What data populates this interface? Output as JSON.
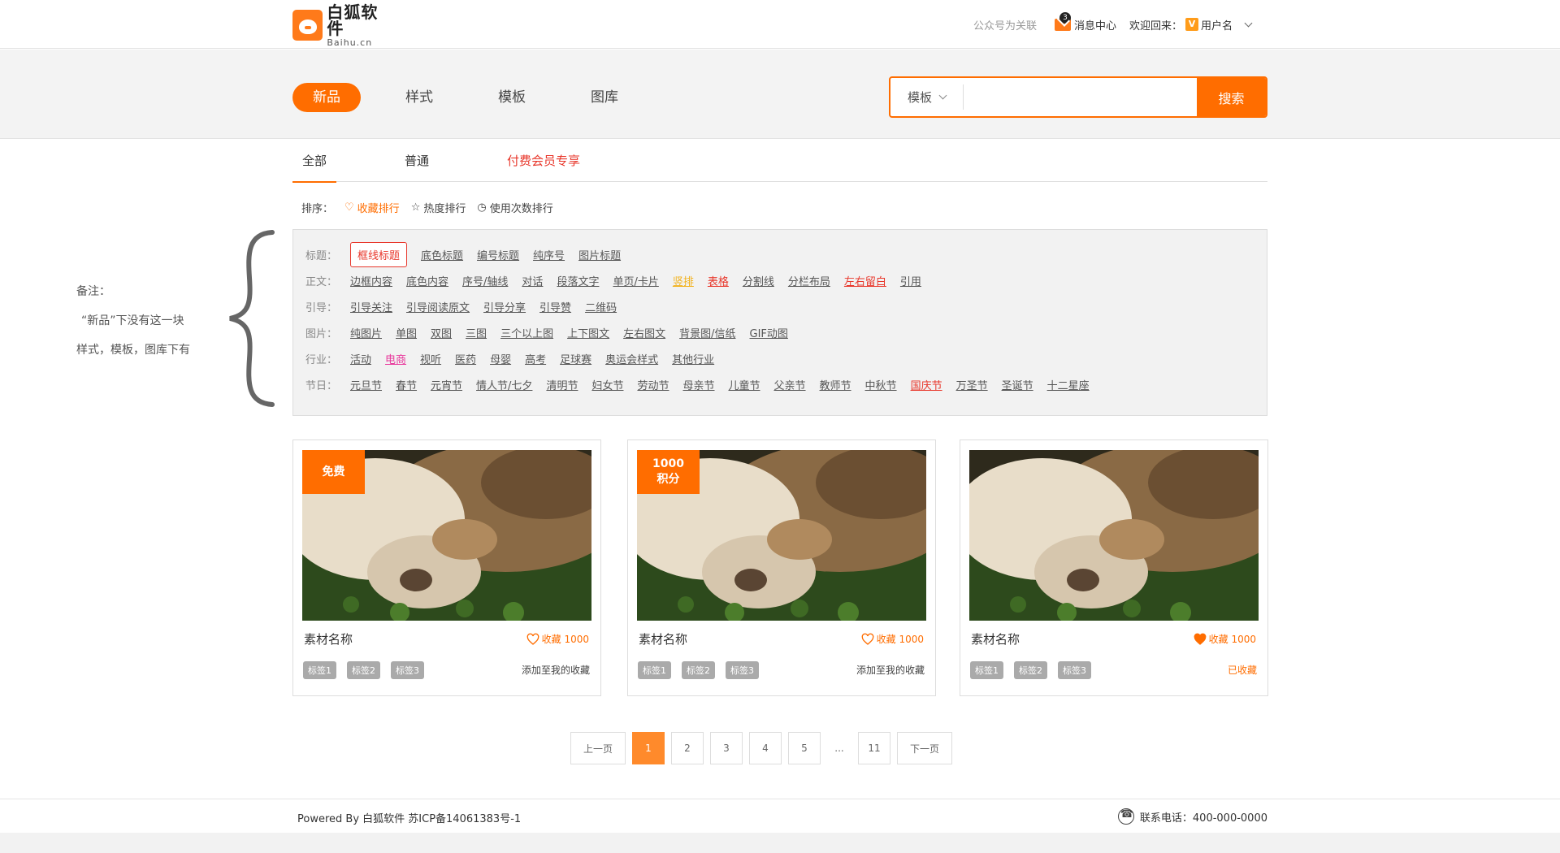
{
  "header": {
    "logo_cn": "白狐软件",
    "logo_en": "Baihu.cn",
    "follow": "公众号为关联",
    "message_count": "3",
    "message_center": "消息中心",
    "welcome": "欢迎回来：",
    "vip_icon": "V",
    "username": "用户名"
  },
  "nav": {
    "tabs": [
      {
        "label": "新品",
        "active": true
      },
      {
        "label": "样式"
      },
      {
        "label": "模板"
      },
      {
        "label": "图库"
      }
    ]
  },
  "search": {
    "type": "模板",
    "placeholder": "",
    "button": "搜索"
  },
  "subtabs": [
    {
      "label": "全部",
      "active": true
    },
    {
      "label": "普通"
    },
    {
      "label": "付费会员专享"
    }
  ],
  "sort": {
    "label": "排序：",
    "items": [
      {
        "icon": "heart-icon",
        "label": "收藏排行",
        "active": true
      },
      {
        "icon": "star-icon",
        "label": "热度排行"
      },
      {
        "icon": "clock-icon",
        "label": "使用次数排行"
      }
    ]
  },
  "note": {
    "line1": "备注：",
    "line2": "“新品”下没有这一块",
    "line3": "样式，模板，图库下有"
  },
  "filters": [
    {
      "label": "标题：",
      "items": [
        {
          "text": "框线标题",
          "style": "sel"
        },
        {
          "text": "底色标题"
        },
        {
          "text": "编号标题"
        },
        {
          "text": "纯序号"
        },
        {
          "text": "图片标题"
        }
      ]
    },
    {
      "label": "正文：",
      "items": [
        {
          "text": "边框内容"
        },
        {
          "text": "底色内容"
        },
        {
          "text": "序号/轴线"
        },
        {
          "text": "对话"
        },
        {
          "text": "段落文字"
        },
        {
          "text": "单页/卡片"
        },
        {
          "text": "竖排",
          "style": "orange"
        },
        {
          "text": "表格",
          "style": "red"
        },
        {
          "text": "分割线"
        },
        {
          "text": "分栏布局"
        },
        {
          "text": "左右留白",
          "style": "red"
        },
        {
          "text": "引用"
        }
      ]
    },
    {
      "label": "引导：",
      "items": [
        {
          "text": "引导关注"
        },
        {
          "text": "引导阅读原文"
        },
        {
          "text": "引导分享"
        },
        {
          "text": "引导赞"
        },
        {
          "text": "二维码"
        }
      ]
    },
    {
      "label": "图片：",
      "items": [
        {
          "text": "纯图片"
        },
        {
          "text": "单图"
        },
        {
          "text": "双图"
        },
        {
          "text": "三图"
        },
        {
          "text": "三个以上图"
        },
        {
          "text": "上下图文"
        },
        {
          "text": "左右图文"
        },
        {
          "text": "背景图/信纸"
        },
        {
          "text": "GIF动图"
        }
      ]
    },
    {
      "label": "行业：",
      "items": [
        {
          "text": "活动"
        },
        {
          "text": "电商",
          "style": "pink"
        },
        {
          "text": "视听"
        },
        {
          "text": "医药"
        },
        {
          "text": "母婴"
        },
        {
          "text": "高考"
        },
        {
          "text": "足球赛"
        },
        {
          "text": "奥运会样式"
        },
        {
          "text": "其他行业"
        }
      ]
    },
    {
      "label": "节日：",
      "items": [
        {
          "text": "元旦节"
        },
        {
          "text": "春节"
        },
        {
          "text": "元宵节"
        },
        {
          "text": "情人节/七夕"
        },
        {
          "text": "清明节"
        },
        {
          "text": "妇女节"
        },
        {
          "text": "劳动节"
        },
        {
          "text": "母亲节"
        },
        {
          "text": "儿童节"
        },
        {
          "text": "父亲节"
        },
        {
          "text": "教师节"
        },
        {
          "text": "中秋节"
        },
        {
          "text": "国庆节",
          "style": "red"
        },
        {
          "text": "万圣节"
        },
        {
          "text": "圣诞节"
        },
        {
          "text": "十二星座"
        }
      ]
    }
  ],
  "cards": [
    {
      "badge": "免费",
      "title": "素材名称",
      "fav_label": "收藏",
      "fav_count": "1000",
      "favorited": false,
      "tags": [
        "标签1",
        "标签2",
        "标签3"
      ],
      "action": "添加至我的收藏"
    },
    {
      "badge": "1000\n积分",
      "title": "素材名称",
      "fav_label": "收藏",
      "fav_count": "1000",
      "favorited": false,
      "tags": [
        "标签1",
        "标签2",
        "标签3"
      ],
      "action": "添加至我的收藏"
    },
    {
      "badge": "",
      "title": "素材名称",
      "fav_label": "收藏",
      "fav_count": "1000",
      "favorited": true,
      "tags": [
        "标签1",
        "标签2",
        "标签3"
      ],
      "action": "已收藏"
    }
  ],
  "pagination": {
    "prev": "上一页",
    "pages": [
      "1",
      "2",
      "3",
      "4",
      "5",
      "...",
      "11"
    ],
    "current": "1",
    "next": "下一页"
  },
  "footer": {
    "powered": "Powered By 白狐软件 苏ICP备14061383号-1",
    "phone": "联系电话：400-000-0000"
  },
  "colors": {
    "accent": "#ff6d00",
    "red": "#e8372b"
  }
}
